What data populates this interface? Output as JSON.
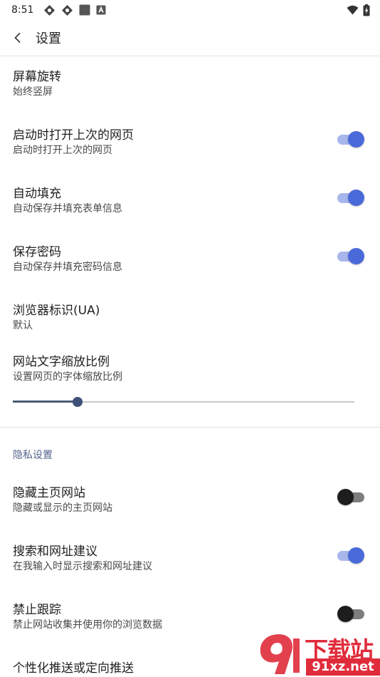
{
  "status_bar": {
    "time": "8:51",
    "left_icons": [
      "vpn-diamond-icon",
      "vpn-diamond-icon",
      "square-app-icon",
      "a-letter-app-icon"
    ],
    "right_icons": [
      "wifi-icon",
      "battery-charging-icon"
    ]
  },
  "app_bar": {
    "back_icon": "chevron-left-icon",
    "title": "设置"
  },
  "settings": [
    {
      "id": "screen-rotation",
      "title": "屏幕旋转",
      "subtitle": "始终竖屏"
    },
    {
      "id": "open-last-pages",
      "title": "启动时打开上次的网页",
      "subtitle": "启动时打开上次的网页",
      "switch": true
    },
    {
      "id": "autofill",
      "title": "自动填充",
      "subtitle": "自动保存并填充表单信息",
      "switch": true
    },
    {
      "id": "save-password",
      "title": "保存密码",
      "subtitle": "自动保存并填充密码信息",
      "switch": true
    },
    {
      "id": "user-agent",
      "title": "浏览器标识(UA)",
      "subtitle": "默认"
    },
    {
      "id": "text-scale",
      "title": "网站文字缩放比例",
      "subtitle": "设置网页的字体缩放比例"
    }
  ],
  "text_scale_slider": {
    "value_fraction": 0.19
  },
  "privacy_section": {
    "header": "隐私设置",
    "items": [
      {
        "id": "hide-home-sites",
        "title": "隐藏主页网站",
        "subtitle": "隐藏或显示的主页网站",
        "switch": false
      },
      {
        "id": "search-suggestions",
        "title": "搜索和网址建议",
        "subtitle": "在我输入时显示搜索和网址建议",
        "switch": true
      },
      {
        "id": "do-not-track",
        "title": "禁止跟踪",
        "subtitle": "禁止网站收集并使用你的浏览数据",
        "switch": false
      },
      {
        "id": "personalized-push",
        "title": "个性化推送或定向推送",
        "subtitle": ""
      }
    ]
  },
  "watermark": {
    "brand": "下载站",
    "url": "91xz.net",
    "color": "#e02b3a"
  },
  "colors": {
    "switch_on_thumb": "#4a6ad9",
    "switch_on_track": "#a8b6ec",
    "switch_off_thumb": "#1d1d1d",
    "section_header": "#55658c"
  }
}
